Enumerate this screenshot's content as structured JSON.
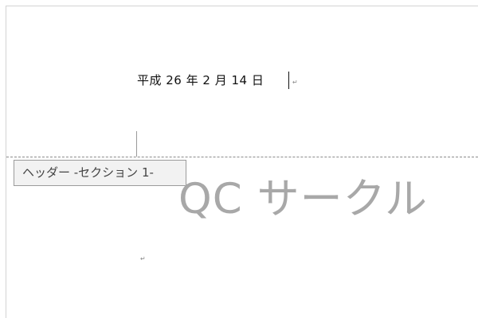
{
  "document": {
    "date_text": "平成 26 年 2 月 14 日",
    "paragraph_mark": "↵"
  },
  "header": {
    "tab_label": "ヘッダー -セクション 1-",
    "watermark_text": "QC サークル"
  }
}
